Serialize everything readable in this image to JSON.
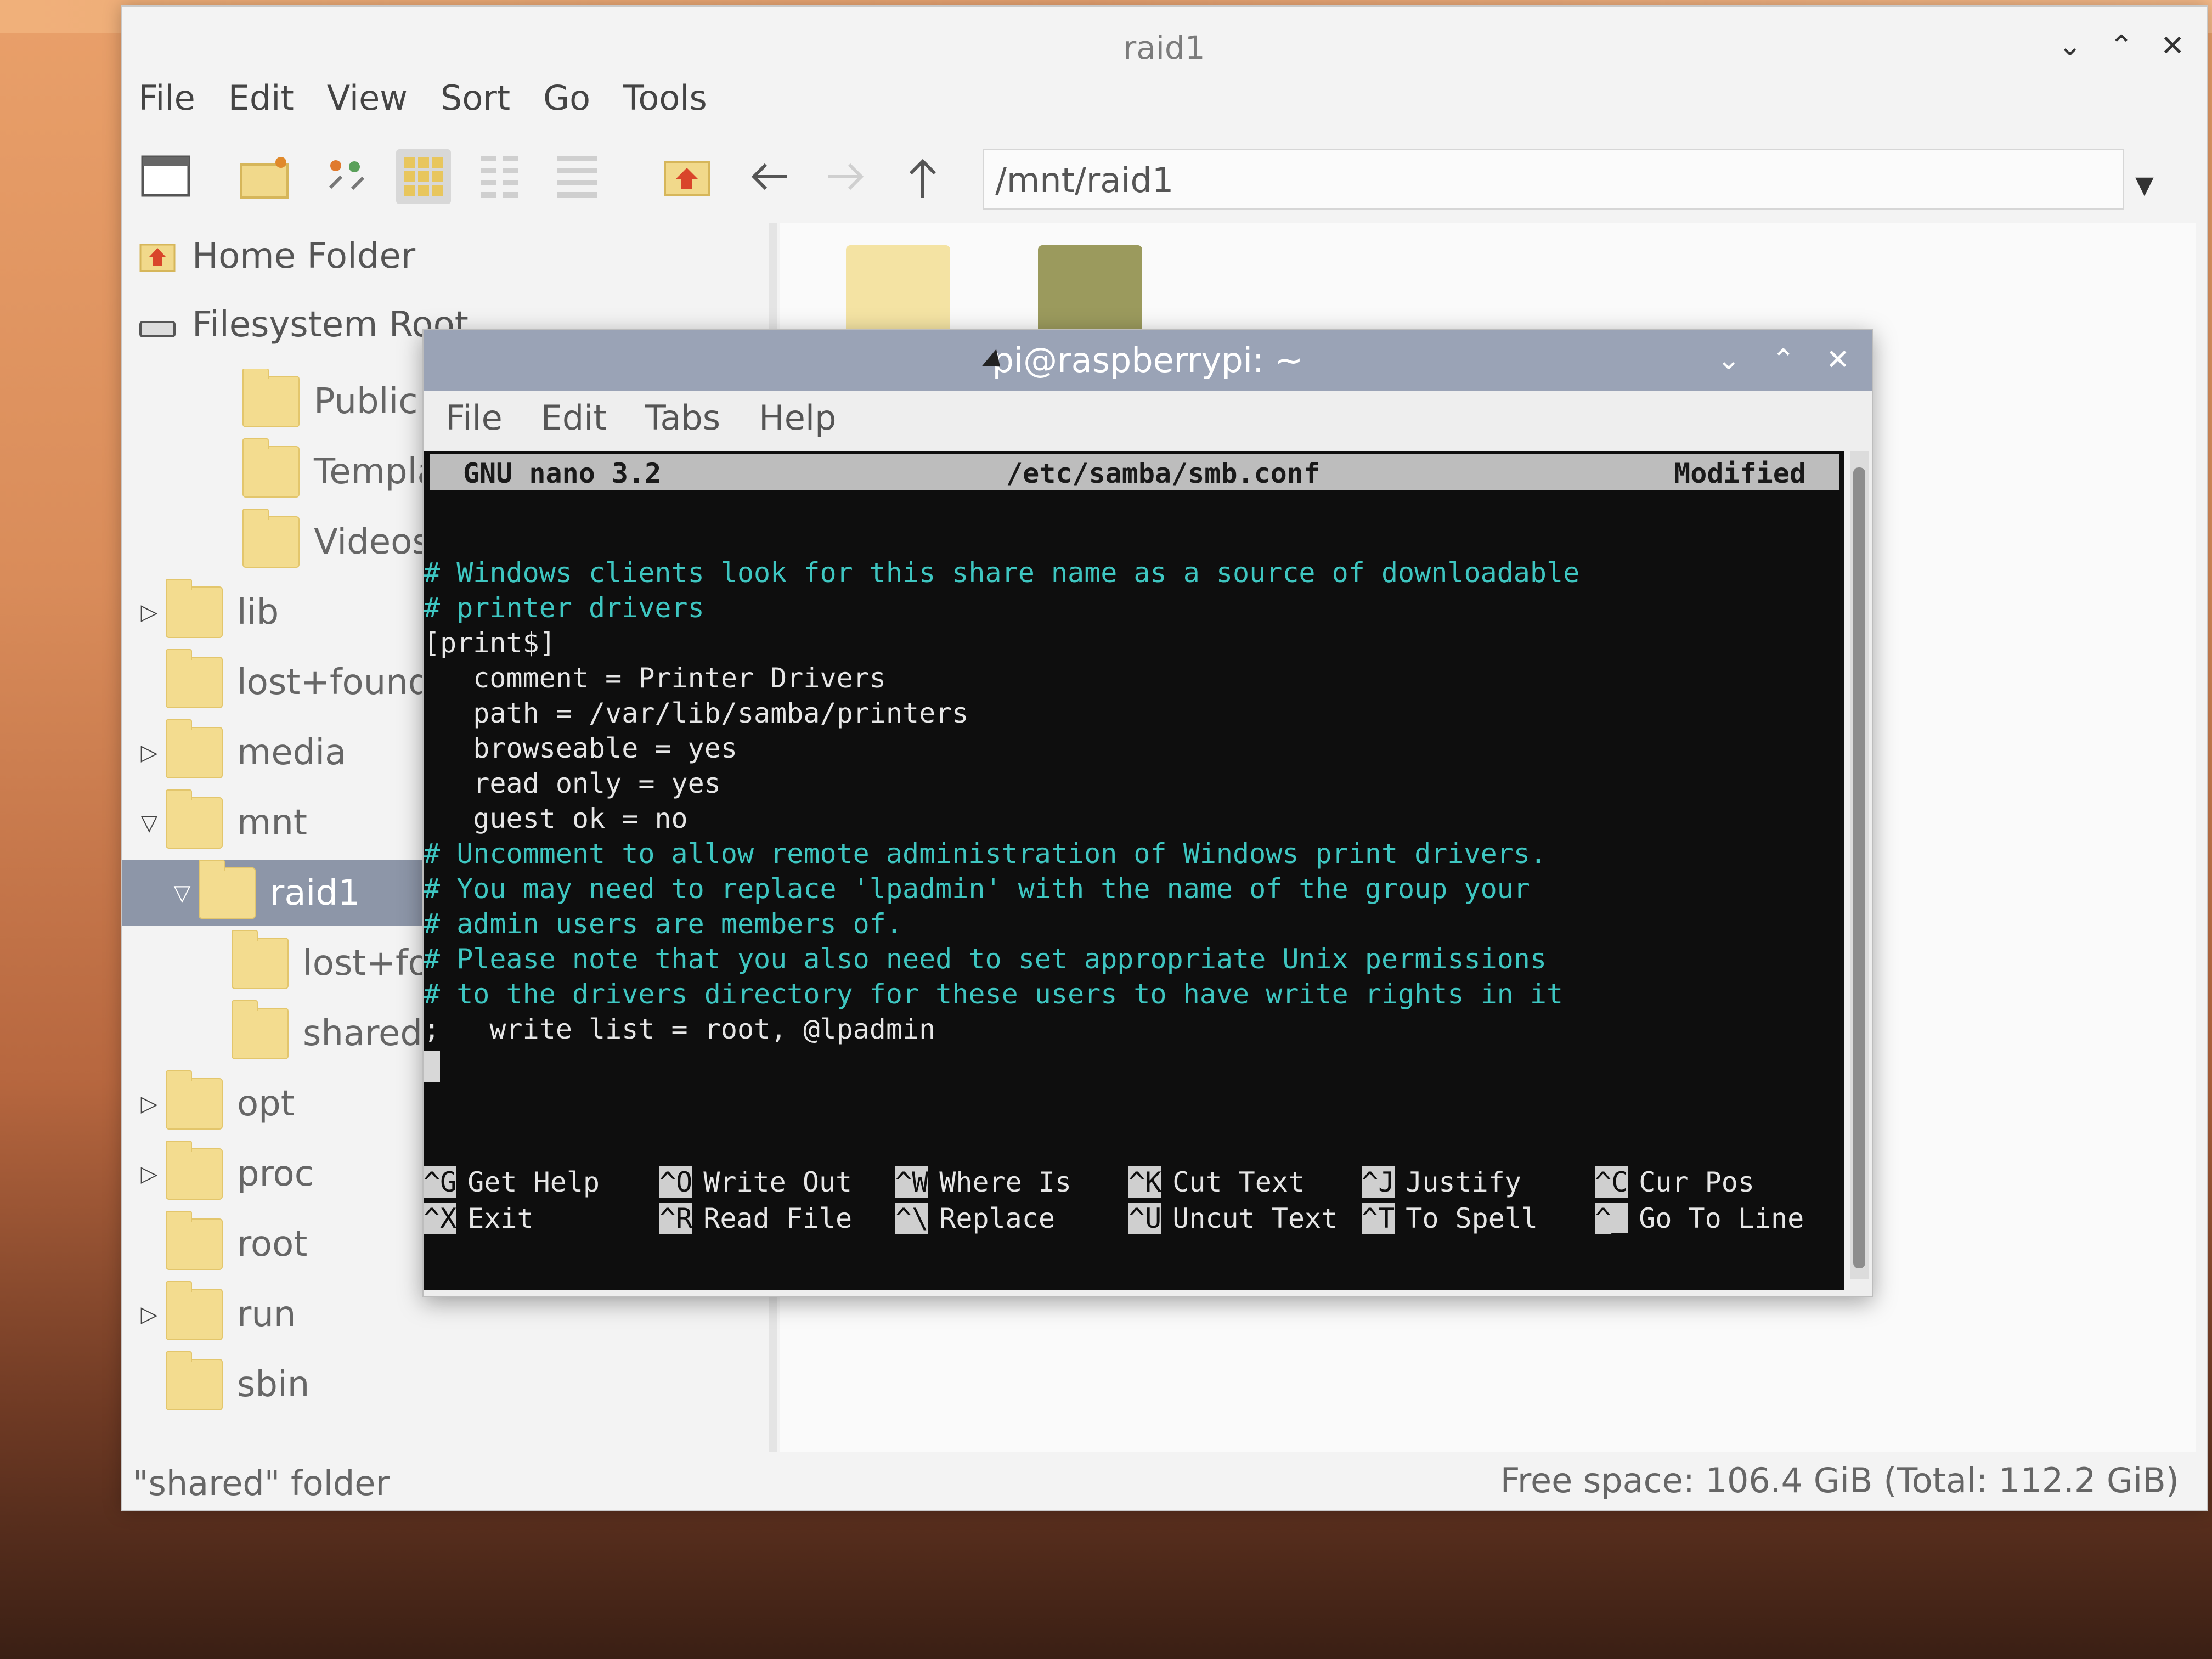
{
  "file_manager": {
    "title": "raid1",
    "window_buttons": [
      "⌄",
      "⌃",
      "✕"
    ],
    "menu": [
      "File",
      "Edit",
      "View",
      "Sort",
      "Go",
      "Tools"
    ],
    "path": "/mnt/raid1",
    "places": [
      {
        "label": "Home Folder",
        "icon": "home-icon"
      },
      {
        "label": "Filesystem Root",
        "icon": "drive-icon"
      }
    ],
    "tree": [
      {
        "label": "Public",
        "expander": ""
      },
      {
        "label": "Templa",
        "expander": ""
      },
      {
        "label": "Videos",
        "expander": ""
      },
      {
        "label": "lib",
        "expander": "▷"
      },
      {
        "label": "lost+found",
        "expander": ""
      },
      {
        "label": "media",
        "expander": "▷"
      },
      {
        "label": "mnt",
        "expander": "▽"
      },
      {
        "label": "raid1",
        "expander": "▽"
      },
      {
        "label": "lost+fo",
        "expander": ""
      },
      {
        "label": "shared",
        "expander": ""
      },
      {
        "label": "opt",
        "expander": "▷"
      },
      {
        "label": "proc",
        "expander": "▷"
      },
      {
        "label": "root",
        "expander": ""
      },
      {
        "label": "run",
        "expander": "▷"
      },
      {
        "label": "sbin",
        "expander": ""
      }
    ],
    "status_left": "\"shared\" folder",
    "status_right": "Free space: 106.4 GiB (Total: 112.2 GiB)"
  },
  "terminal": {
    "title": "pi@raspberrypi: ~",
    "window_buttons": [
      "⌄",
      "⌃",
      "✕"
    ],
    "menu": [
      "File",
      "Edit",
      "Tabs",
      "Help"
    ],
    "nano_version": "GNU nano 3.2",
    "file": "/etc/samba/smb.conf",
    "status": "Modified",
    "lines": [
      {
        "text": "# Windows clients look for this share name as a source of downloadable",
        "comment": true
      },
      {
        "text": "# printer drivers",
        "comment": true
      },
      {
        "text": "[print$]",
        "comment": false
      },
      {
        "text": "   comment = Printer Drivers",
        "comment": false
      },
      {
        "text": "   path = /var/lib/samba/printers",
        "comment": false
      },
      {
        "text": "   browseable = yes",
        "comment": false
      },
      {
        "text": "   read only = yes",
        "comment": false
      },
      {
        "text": "   guest ok = no",
        "comment": false
      },
      {
        "text": "# Uncomment to allow remote administration of Windows print drivers.",
        "comment": true
      },
      {
        "text": "# You may need to replace 'lpadmin' with the name of the group your",
        "comment": true
      },
      {
        "text": "# admin users are members of.",
        "comment": true
      },
      {
        "text": "# Please note that you also need to set appropriate Unix permissions",
        "comment": true
      },
      {
        "text": "# to the drivers directory for these users to have write rights in it",
        "comment": true
      },
      {
        "text": ";   write list = root, @lpadmin",
        "comment": false
      }
    ],
    "shortcuts": [
      {
        "key": "^G",
        "label": "Get Help"
      },
      {
        "key": "^X",
        "label": "Exit"
      },
      {
        "key": "^O",
        "label": "Write Out"
      },
      {
        "key": "^R",
        "label": "Read File"
      },
      {
        "key": "^W",
        "label": "Where Is"
      },
      {
        "key": "^\\",
        "label": "Replace"
      },
      {
        "key": "^K",
        "label": "Cut Text"
      },
      {
        "key": "^U",
        "label": "Uncut Text"
      },
      {
        "key": "^J",
        "label": "Justify"
      },
      {
        "key": "^T",
        "label": "To Spell"
      },
      {
        "key": "^C",
        "label": "Cur Pos"
      },
      {
        "key": "^_",
        "label": "Go To Line"
      }
    ]
  },
  "colors": {
    "comment": "#3ec6c1",
    "terminal_bg": "#0e0e0e",
    "selection": "#8d96a8",
    "folder": "#f3dc8f"
  }
}
